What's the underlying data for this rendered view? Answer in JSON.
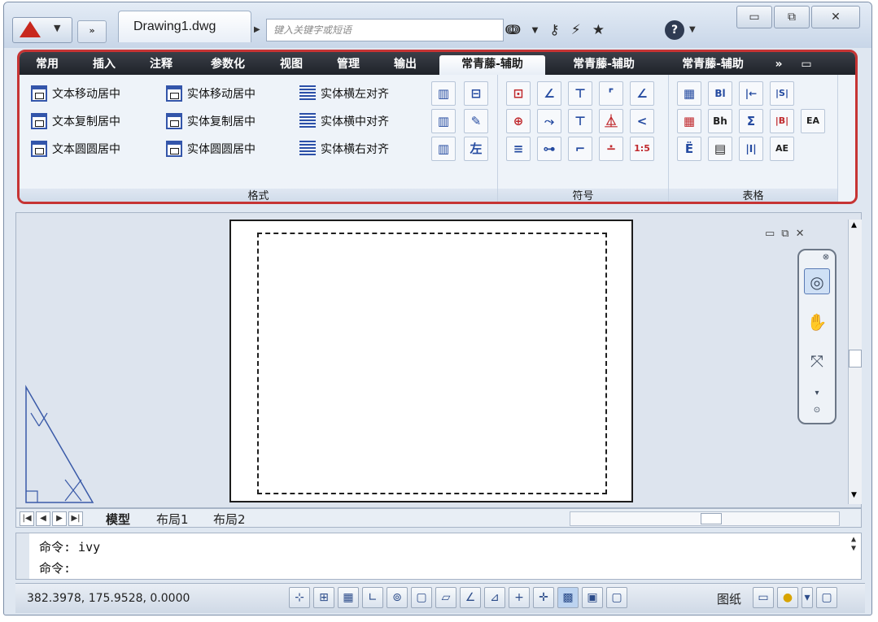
{
  "titlebar": {
    "document_title": "Drawing1.dwg",
    "qa_label": "»",
    "search_placeholder": "键入关键字或短语",
    "tool_icons": [
      "binoculars-icon",
      "key-icon",
      "satellite-icon",
      "star-icon"
    ],
    "help_label": "?",
    "window_controls": {
      "minimize": "▭",
      "restore": "⧉",
      "close": "✕"
    }
  },
  "ribbon": {
    "tabs": [
      "常用",
      "插入",
      "注释",
      "参数化",
      "视图",
      "管理",
      "输出",
      "常青藤-辅助",
      "常青藤-辅助",
      "常青藤-辅助",
      "»",
      "▭"
    ],
    "active_tab_index": 7,
    "panels": {
      "format": {
        "label": "格式",
        "commands": [
          "文本移动居中",
          "实体移动居中",
          "实体横左对齐",
          "文本复制居中",
          "实体复制居中",
          "实体横中对齐",
          "文本圆圆居中",
          "实体圆圆居中",
          "实体横右对齐"
        ],
        "small_icons": [
          "▥",
          "⊟",
          "▥",
          "✎",
          "▥",
          "左"
        ]
      },
      "symbol": {
        "label": "符号",
        "buttons": [
          "⊡",
          "∠",
          "⊤",
          "⌜",
          "∠",
          "⊕",
          "⤳",
          "⊤",
          "⏅",
          "<",
          "≡",
          "⊶",
          "⌐",
          "∸",
          "1:5"
        ]
      },
      "table": {
        "label": "表格",
        "buttons": [
          "▦",
          "Bl",
          "|←",
          "|S|",
          "▦",
          "Bh",
          "Σ",
          "|B|",
          "EA",
          "Ё",
          "▤",
          "|I|",
          "AE"
        ]
      }
    }
  },
  "drawing": {
    "view_controls": [
      "▭",
      "⧉",
      "✕"
    ],
    "nav_tools": [
      "steering-wheel-2d-icon",
      "pan-hand-icon",
      "zoom-icon",
      "chevron-down-icon"
    ]
  },
  "layout_tabs": {
    "tabs": [
      "模型",
      "布局1",
      "布局2"
    ],
    "active_index": 0
  },
  "command": {
    "history": "命令: ivy",
    "prompt": "命令:"
  },
  "status": {
    "coordinates": "382.3978,  175.9528,  0.0000",
    "paper_label": "图纸",
    "toggle_buttons": [
      "⊹",
      "⊞",
      "▦",
      "∟",
      "⊚",
      "▢",
      "▱",
      "∠",
      "⊿",
      "+",
      "✛",
      "▩",
      "▣",
      "▢"
    ]
  }
}
